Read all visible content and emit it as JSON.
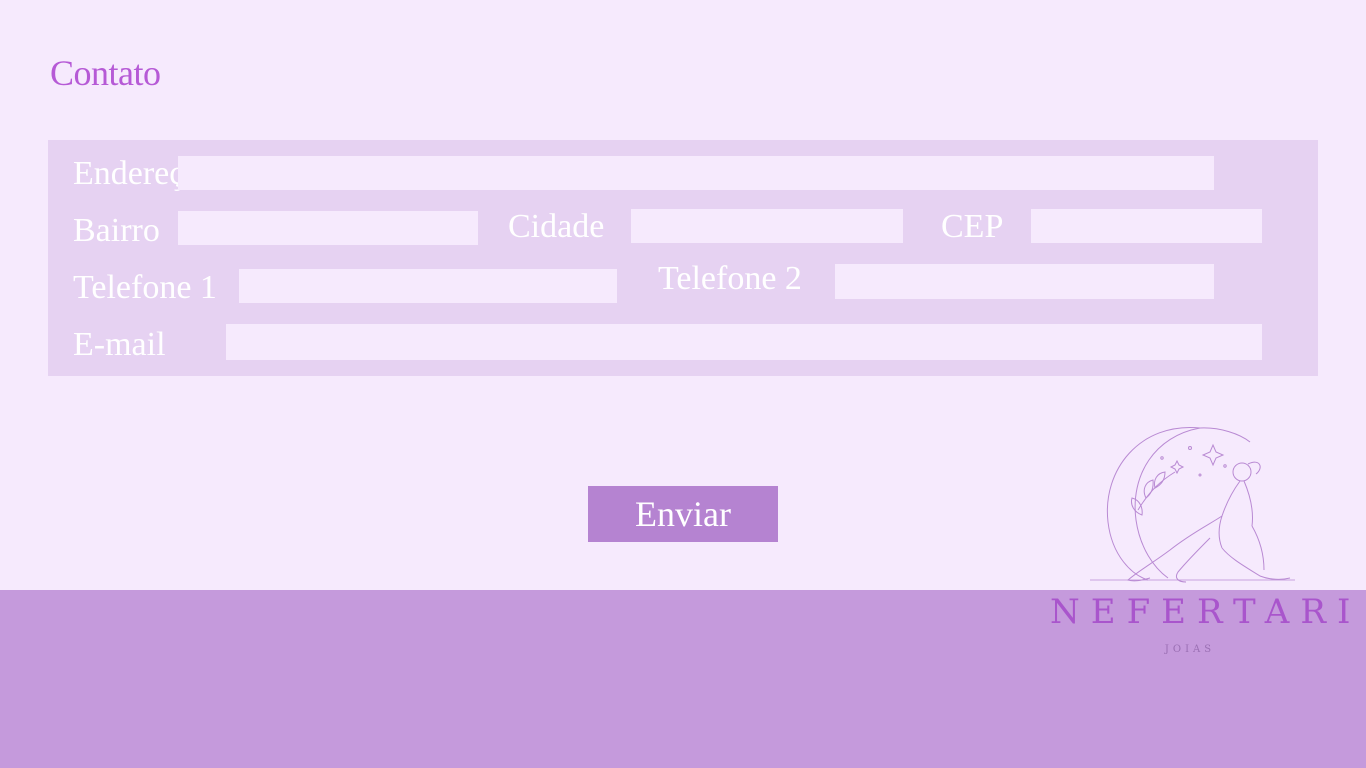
{
  "page": {
    "title": "Contato"
  },
  "form": {
    "labels": {
      "endereco": "Endereço",
      "bairro": "Bairro",
      "cidade": "Cidade",
      "cep": "CEP",
      "telefone1": "Telefone 1",
      "telefone2": "Telefone 2",
      "email": "E-mail"
    },
    "values": {
      "endereco": "",
      "bairro": "",
      "cidade": "",
      "cep": "",
      "telefone1": "",
      "telefone2": "",
      "email": ""
    },
    "submit_label": "Enviar"
  },
  "brand": {
    "name": "NEFERTARI",
    "tagline": "JOIAS",
    "logo_icon": "moon-woman-illustration-icon"
  },
  "colors": {
    "background": "#f6eafd",
    "panel": "#e6d2f2",
    "accent": "#b65ad6",
    "button": "#b583d1",
    "footer": "#c59adc"
  }
}
